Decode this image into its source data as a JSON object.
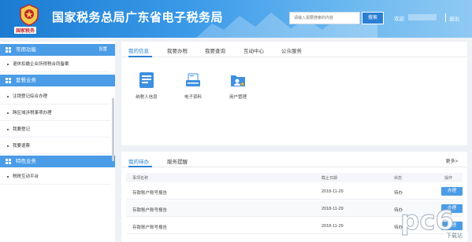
{
  "header": {
    "emblem_text": "国家税务",
    "title": "国家税务总局广东省电子税务局",
    "search_placeholder": "请输入需要搜索的内容",
    "search_button": "搜索",
    "welcome": "欢迎",
    "logout": "退出"
  },
  "sidebar": {
    "sections": [
      {
        "title": "常用功能",
        "action": "设置",
        "items": [
          "退休扣缴企业所得税合同备案"
        ]
      },
      {
        "title": "套餐业务",
        "items": [
          "注销登记综合办理",
          "跨区域涉税事项办理",
          "我要登记",
          "我要退票"
        ]
      },
      {
        "title": "特色业务",
        "items": [
          "税税互动平台"
        ]
      }
    ]
  },
  "main": {
    "tabs": [
      "我的信息",
      "我要办税",
      "我要查询",
      "互动中心",
      "公众服务"
    ],
    "apps": [
      {
        "label": "纳税人信息",
        "icon": "taxpayer-info-icon"
      },
      {
        "label": "电子资料",
        "icon": "electronic-docs-icon"
      },
      {
        "label": "用户管理",
        "icon": "user-management-icon"
      }
    ],
    "todo": {
      "tabs": [
        "我的待办",
        "服务提醒"
      ],
      "more": "更多>",
      "columns": [
        "事项名称",
        "截止日期",
        "状态",
        "操作"
      ],
      "rows": [
        {
          "name": "存款账户账号报告",
          "date": "2018-11-29",
          "status": "待办",
          "action": "办理"
        },
        {
          "name": "存款账户账号报告",
          "date": "2018-11-29",
          "status": "待办",
          "action": "办理"
        },
        {
          "name": "存款账户账号报告",
          "date": "2018-11-29",
          "status": "待办",
          "action": "办理"
        }
      ]
    }
  },
  "watermark": {
    "text": "pc6",
    "sub": "下载站"
  },
  "colors": {
    "primary": "#2a7fd4",
    "sidebar_head": "#4a9ce6",
    "emblem_red": "#c0262c"
  }
}
